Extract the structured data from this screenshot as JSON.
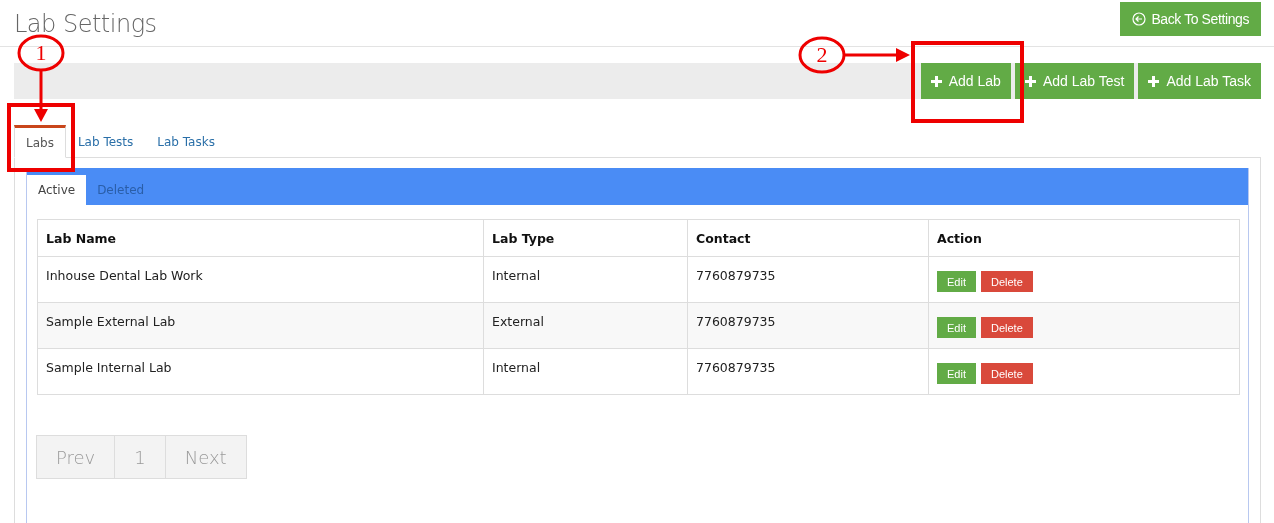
{
  "page": {
    "title": "Lab Settings",
    "back_button": "Back To Settings"
  },
  "toolbar": {
    "buttons": [
      "Add Lab",
      "Add Lab Test",
      "Add Lab Task"
    ]
  },
  "tabs": [
    {
      "label": "Labs",
      "selected": true
    },
    {
      "label": "Lab Tests",
      "selected": false
    },
    {
      "label": "Lab Tasks",
      "selected": false
    }
  ],
  "subtabs": [
    {
      "label": "Active",
      "selected": true
    },
    {
      "label": "Deleted",
      "selected": false
    }
  ],
  "table": {
    "columns": [
      "Lab Name",
      "Lab Type",
      "Contact",
      "Action"
    ],
    "rows": [
      {
        "name": "Inhouse Dental Lab Work",
        "type": "Internal",
        "contact": "7760879735",
        "actions": [
          "Edit",
          "Delete"
        ]
      },
      {
        "name": "Sample External Lab",
        "type": "External",
        "contact": "7760879735",
        "actions": [
          "Edit",
          "Delete"
        ]
      },
      {
        "name": "Sample Internal Lab",
        "type": "Internal",
        "contact": "7760879735",
        "actions": [
          "Edit",
          "Delete"
        ]
      }
    ]
  },
  "pagination": {
    "prev": "Prev",
    "pages": [
      "1"
    ],
    "next": "Next"
  },
  "annotations": [
    {
      "label": "1"
    },
    {
      "label": "2"
    }
  ]
}
